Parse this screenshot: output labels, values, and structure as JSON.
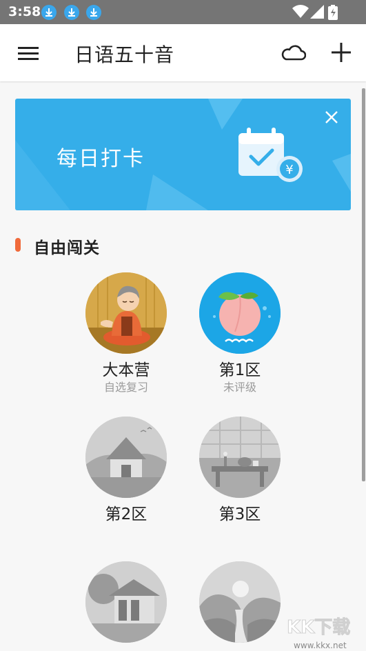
{
  "status_bar": {
    "time": "3:58"
  },
  "app_bar": {
    "title": "日语五十音"
  },
  "banner": {
    "text": "每日打卡",
    "currency_symbol": "¥"
  },
  "section": {
    "title": "自由闯关"
  },
  "zones": [
    {
      "name": "大本营",
      "sub": "自选复习"
    },
    {
      "name": "第1区",
      "sub": "未评级"
    },
    {
      "name": "第2区",
      "sub": ""
    },
    {
      "name": "第3区",
      "sub": ""
    },
    {
      "name": "",
      "sub": ""
    },
    {
      "name": "",
      "sub": ""
    }
  ],
  "watermark": {
    "brand": "KK下载",
    "url": "www.kkx.net"
  },
  "colors": {
    "status_bar": "#757575",
    "banner": "#35aee9",
    "accent": "#f06a3b",
    "zone0_bg": "#d6a84a",
    "zone1_bg": "#1ca6e6",
    "locked": "#c4c4c4"
  }
}
